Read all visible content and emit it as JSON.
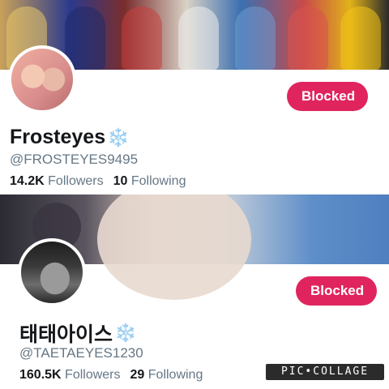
{
  "profiles": [
    {
      "display_name": "Frosteyes",
      "name_emoji": "❄️",
      "handle": "@FROSTEYES9495",
      "followers_count": "14.2K",
      "followers_label": "Followers",
      "following_count": "10",
      "following_label": "Following",
      "button_label": "Blocked",
      "banner": "group photo",
      "avatar": "two-person photo"
    },
    {
      "display_name": "태태아이스",
      "name_emoji": "❄️",
      "handle": "@TAETAEYES1230",
      "followers_count": "160.5K",
      "followers_label": "Followers",
      "following_count": "29",
      "following_label": "Following",
      "button_label": "Blocked",
      "banner": "close-up profile photo",
      "avatar": "black-and-white portrait"
    }
  ],
  "watermark": "PIC•COLLAGE",
  "colors": {
    "accent": "#e0245e",
    "secondary_text": "#657786",
    "primary_text": "#14171a"
  }
}
